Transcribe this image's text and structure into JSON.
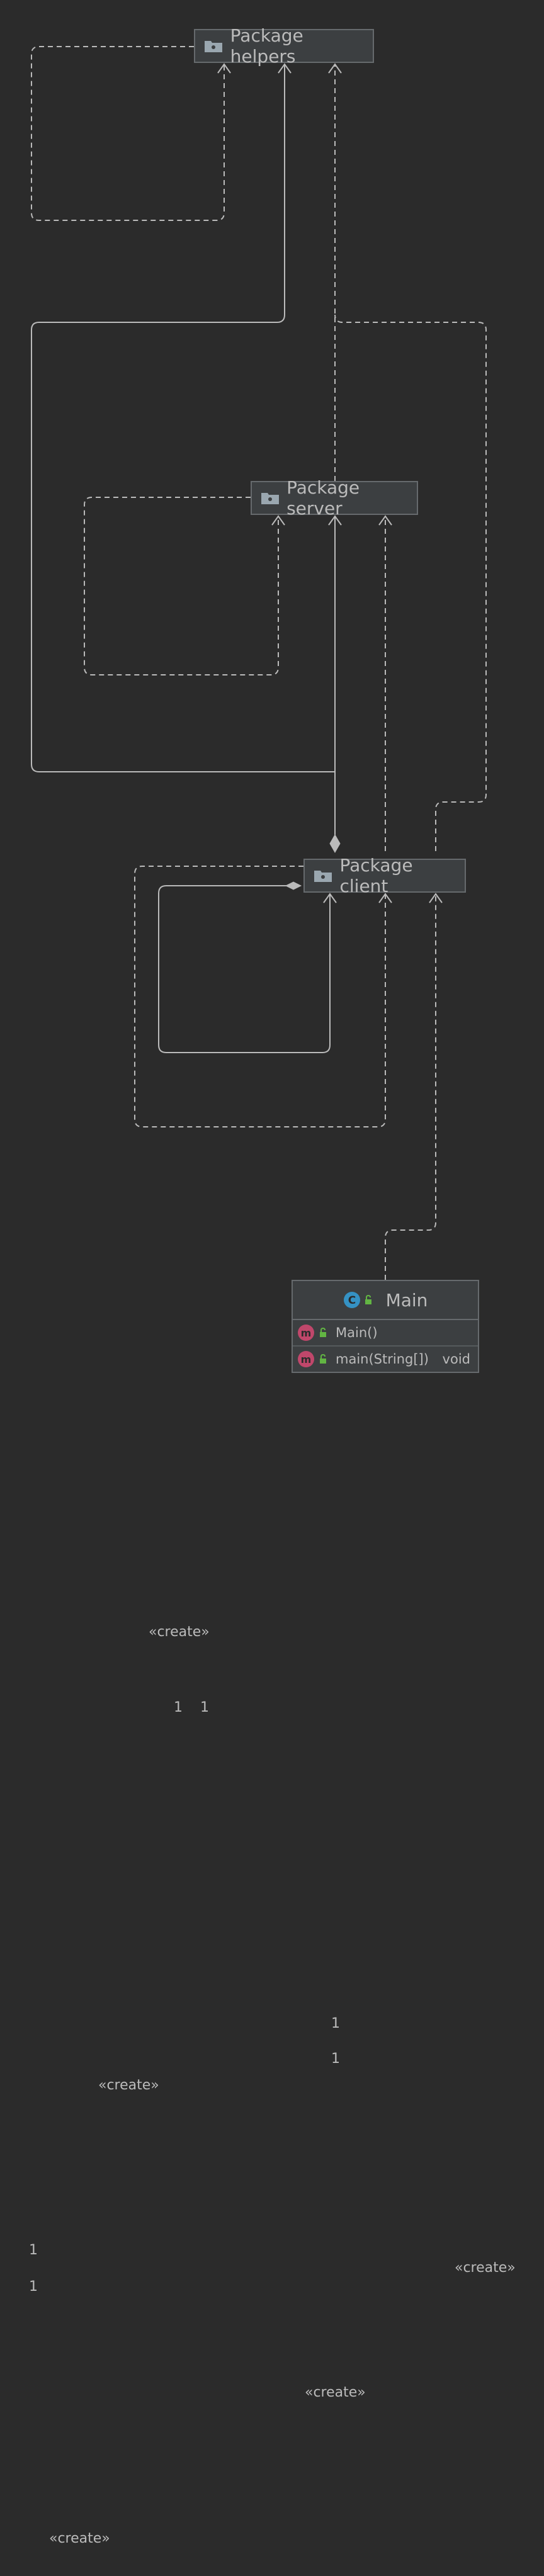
{
  "packages": {
    "helpers": "Package helpers",
    "server": "Package server",
    "client": "Package client"
  },
  "class_main": {
    "name": "Main",
    "members": [
      {
        "name": "Main()",
        "type": ""
      },
      {
        "name": "main(String[])",
        "type": "void"
      }
    ]
  },
  "labels": {
    "create_1": "«create»",
    "create_2": "«create»",
    "create_3": "«create»",
    "create_4": "«create»",
    "create_5": "«create»",
    "mult_1": "1",
    "mult_2": "1",
    "mult_3": "1",
    "mult_4": "1",
    "mult_5": "1",
    "mult_6": "1"
  },
  "icons": {
    "package": "folder-package-icon",
    "class": "class-icon",
    "method": "method-icon",
    "visibility": "public-lock-icon"
  },
  "colors": {
    "background": "#2b2b2b",
    "node_fill": "#3c3f41",
    "node_border": "#666a6d",
    "edge": "#bbbbbb",
    "method_badge": "#c0476b",
    "class_badge": "#3592c4"
  }
}
